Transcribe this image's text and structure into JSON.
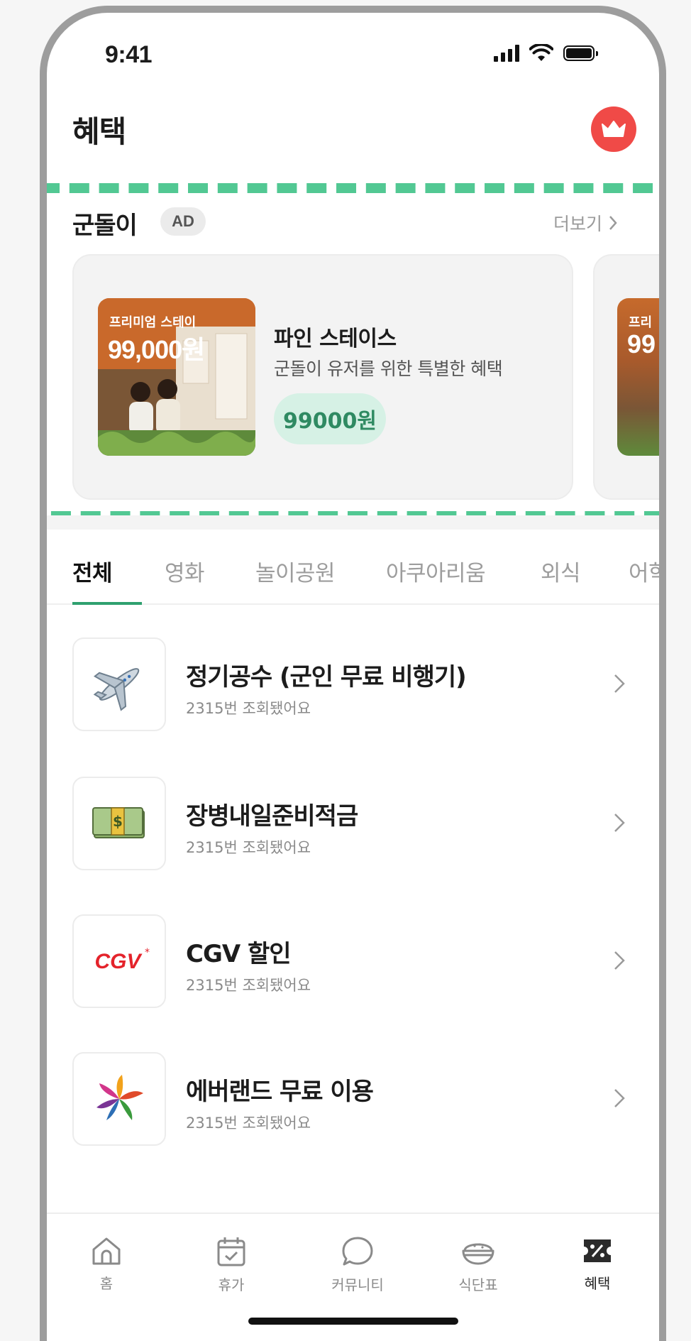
{
  "status_bar": {
    "time": "9:41"
  },
  "header": {
    "title": "혜택"
  },
  "ad": {
    "title": "군돌이",
    "badge": "AD",
    "more_label": "더보기",
    "card": {
      "thumb_tag": "프리미엄 스테이",
      "thumb_price": "99,000원",
      "name": "파인 스테이스",
      "description": "군돌이 유저를 위한 특별한 혜택",
      "price": "99000원"
    },
    "peek_card": {
      "thumb_tag": "프리",
      "thumb_price": "99"
    }
  },
  "tabs": [
    {
      "label": "전체"
    },
    {
      "label": "영화"
    },
    {
      "label": "놀이공원"
    },
    {
      "label": "아쿠아리움"
    },
    {
      "label": "외식"
    },
    {
      "label": "어학"
    }
  ],
  "list": [
    {
      "title": "정기공수 (군인 무료 비행기)",
      "subtitle": "2315번 조회됐어요",
      "icon": "airplane-icon"
    },
    {
      "title": "장병내일준비적금",
      "subtitle": "2315번 조회됐어요",
      "icon": "money-icon"
    },
    {
      "title": "CGV 할인",
      "subtitle": "2315번 조회됐어요",
      "icon": "cgv-logo",
      "logo_text": "CGV"
    },
    {
      "title": "에버랜드 무료 이용",
      "subtitle": "2315번 조회됐어요",
      "icon": "everland-logo"
    }
  ],
  "bottom_nav": [
    {
      "label": "홈",
      "icon": "home-icon"
    },
    {
      "label": "휴가",
      "icon": "calendar-icon"
    },
    {
      "label": "커뮤니티",
      "icon": "chat-icon"
    },
    {
      "label": "식단표",
      "icon": "rice-bowl-icon"
    },
    {
      "label": "혜택",
      "icon": "coupon-icon",
      "active": true
    }
  ],
  "colors": {
    "accent": "#2fa06f",
    "crown": "#f04a47",
    "dashed_highlight": "#52c893",
    "price_pill": "#d6f1e5"
  }
}
